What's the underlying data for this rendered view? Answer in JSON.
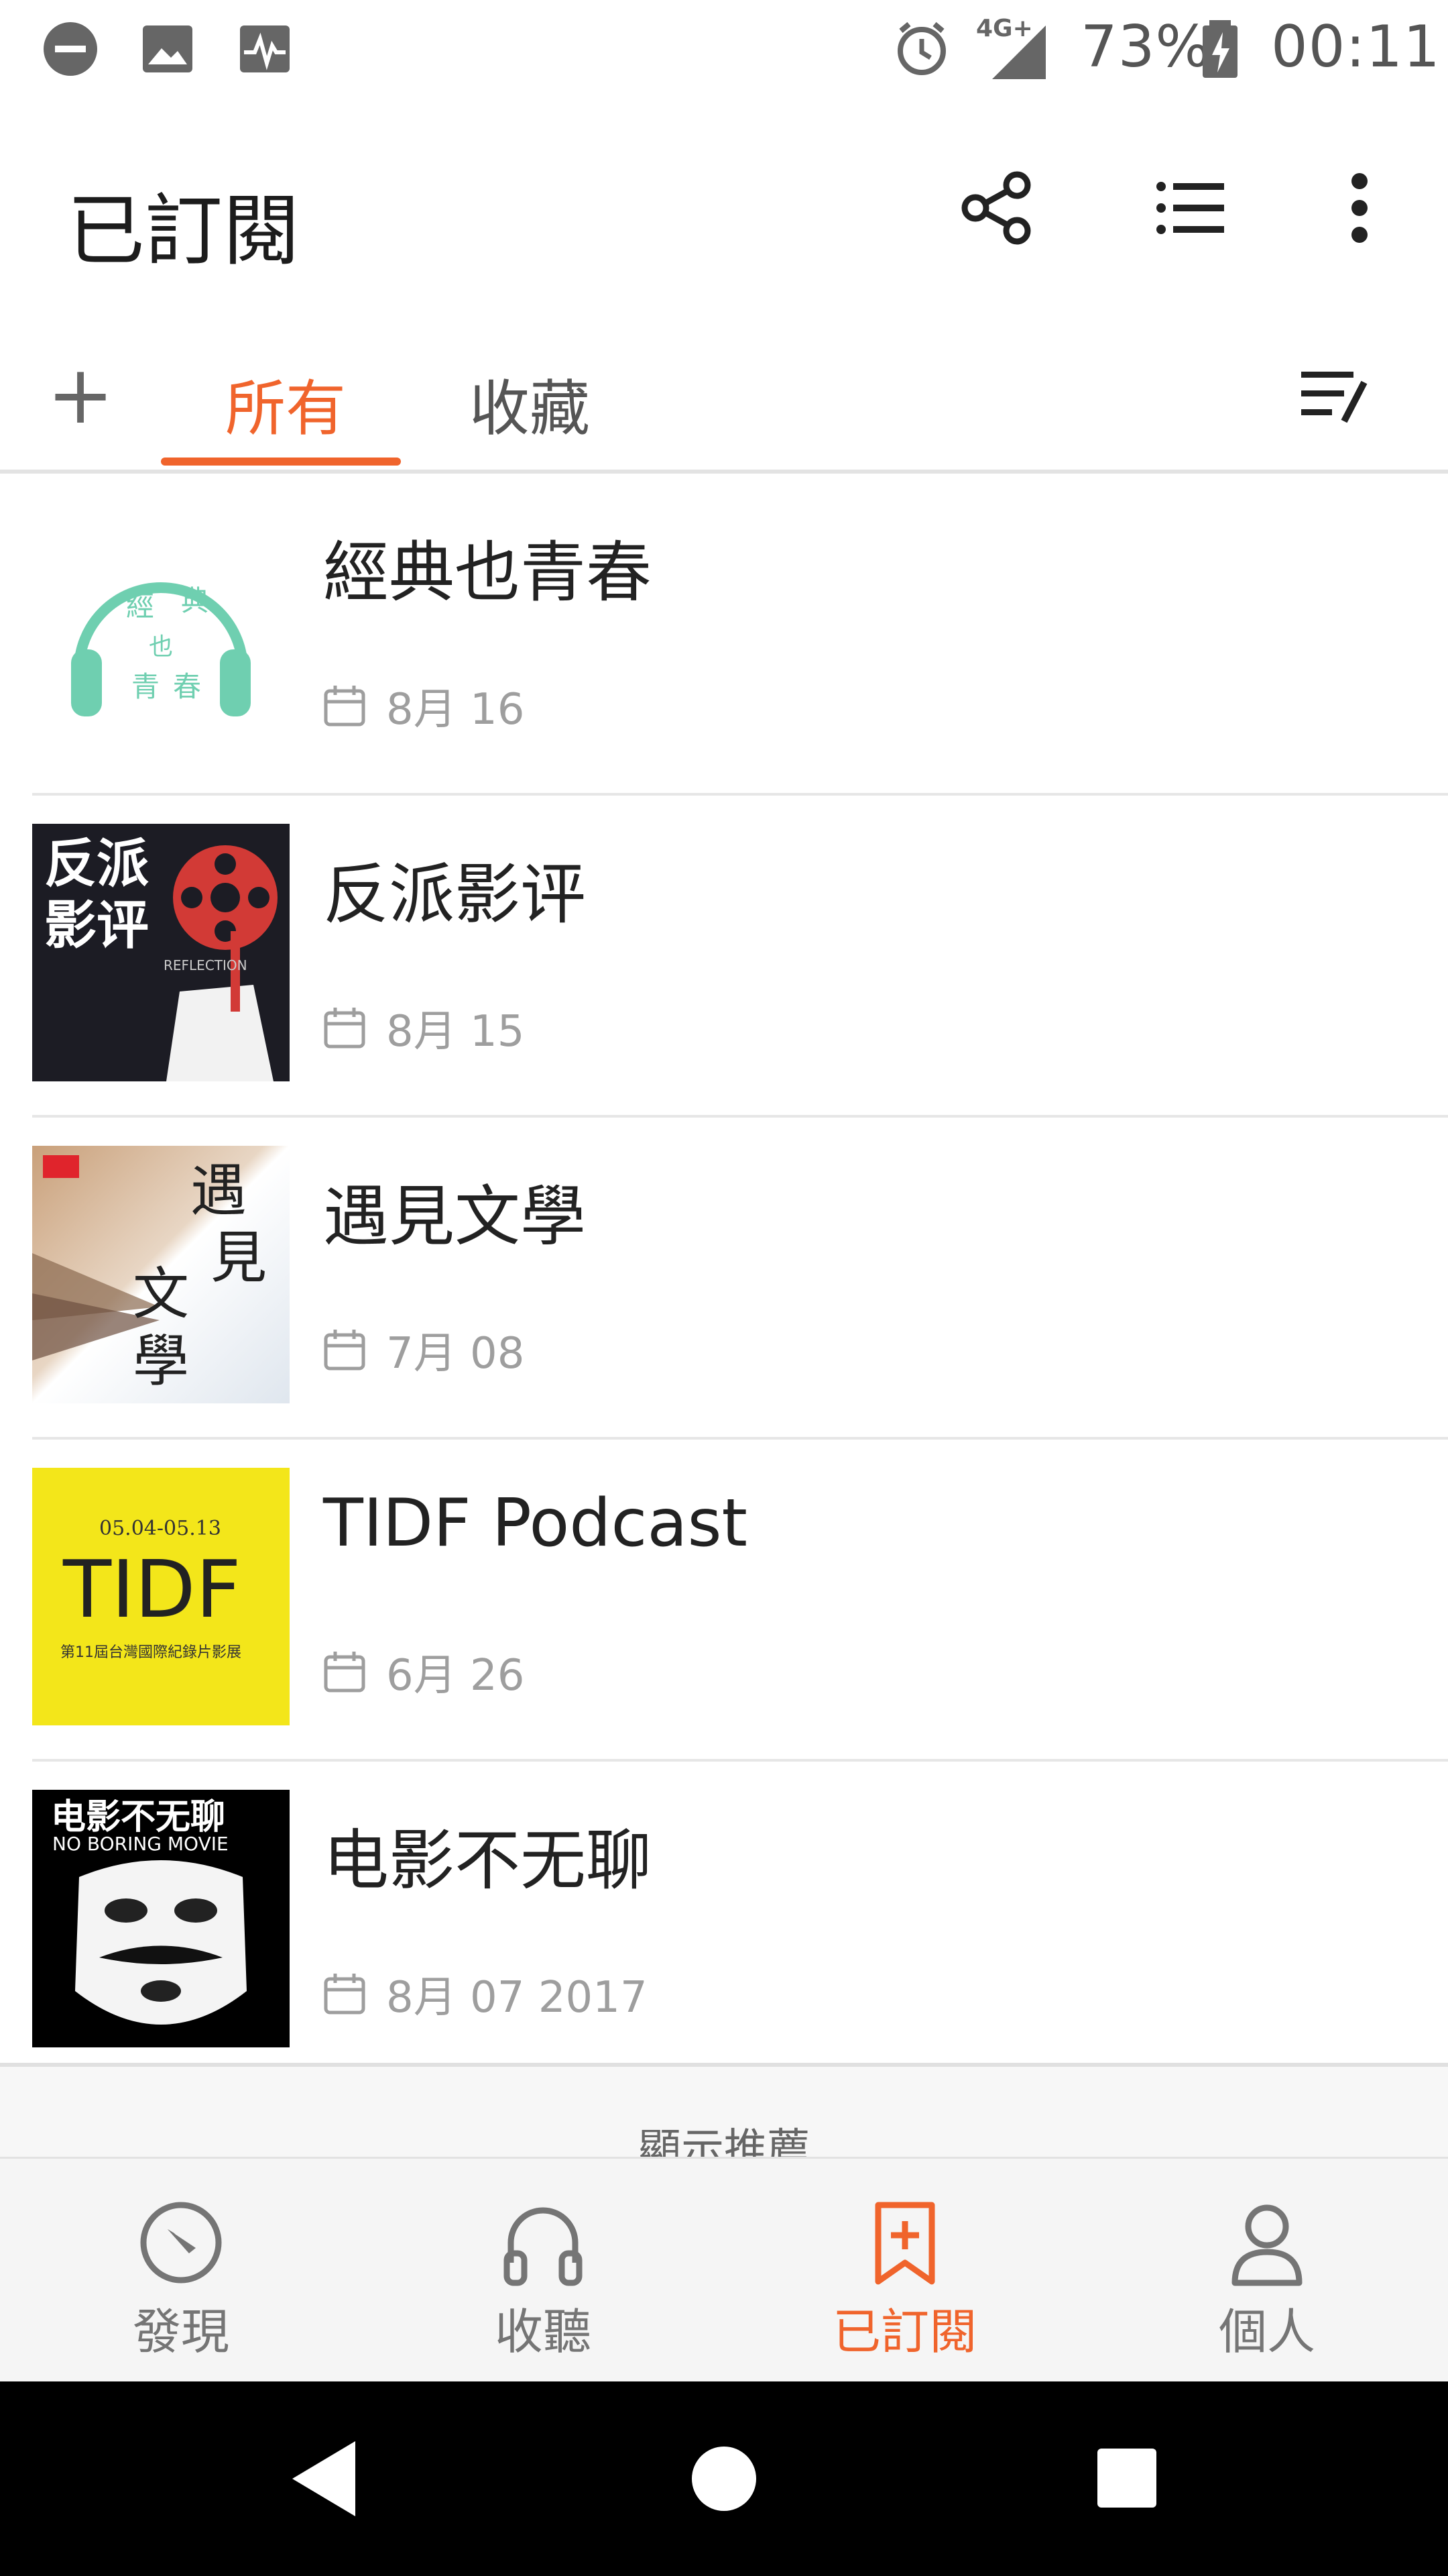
{
  "status_bar": {
    "network": "4G+",
    "battery": "73%",
    "time": "00:11"
  },
  "app_bar": {
    "title": "已訂閱"
  },
  "tabs": {
    "add_label": "+",
    "items": [
      {
        "label": "所有",
        "active": true
      },
      {
        "label": "收藏",
        "active": false
      }
    ]
  },
  "subscriptions": [
    {
      "title": "經典也青春",
      "date": "8月 16"
    },
    {
      "title": "反派影评",
      "date": "8月 15"
    },
    {
      "title": "遇見文學",
      "date": "7月 08"
    },
    {
      "title": "TIDF Podcast",
      "date": "6月 26"
    },
    {
      "title": "电影不无聊",
      "date": "8月 07 2017"
    }
  ],
  "thumbnail_text": {
    "classic_1": "經",
    "classic_2": "典",
    "classic_3": "也",
    "classic_4": "青",
    "classic_5": "春",
    "villain_line1": "反派",
    "villain_line2": "影评",
    "villain_tag": "REFLECTION",
    "literature_1": "遇",
    "literature_2": "見",
    "literature_3": "文",
    "literature_4": "學",
    "tidf_dates": "05.04-05.13",
    "tidf_big": "TIDF",
    "tidf_sub": "第11屆台灣國際紀錄片影展",
    "movie_cn": "电影不无聊",
    "movie_en": "NO BORING MOVIE"
  },
  "recommend_label": "顯示推薦",
  "bottom_nav": [
    {
      "label": "發現",
      "icon": "compass-icon",
      "active": false
    },
    {
      "label": "收聽",
      "icon": "headphones-icon",
      "active": false
    },
    {
      "label": "已訂閱",
      "icon": "bookmark-add-icon",
      "active": true
    },
    {
      "label": "個人",
      "icon": "person-icon",
      "active": false
    }
  ],
  "colors": {
    "accent": "#f0642c",
    "text_primary": "#222222",
    "text_secondary": "#9e9e9e",
    "classic_green": "#6fcfb0",
    "tidf_yellow": "#f3e61a"
  }
}
